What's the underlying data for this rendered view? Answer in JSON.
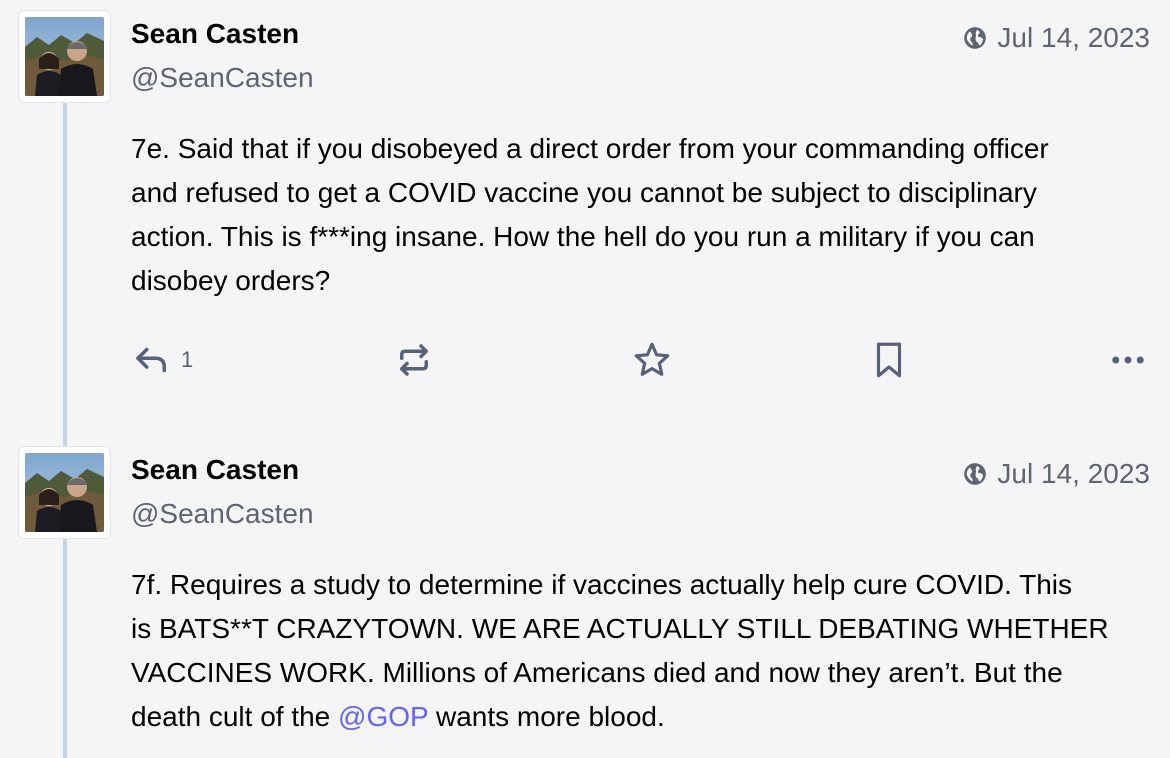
{
  "statuses": [
    {
      "display_name": "Sean Casten",
      "handle": "@SeanCasten",
      "date": "Jul 14, 2023",
      "visibility_icon": "globe-icon",
      "lines": [
        "7e. Said that if you disobeyed a direct order from your commanding officer",
        "and refused to get a COVID vaccine you cannot be subject to disciplinary",
        "action.  This is f***ing insane.  How the hell do you run a military if you can",
        "disobey orders?"
      ],
      "actions": {
        "reply_icon": "reply-icon",
        "reply_count": "1",
        "boost_icon": "boost-icon",
        "favourite_icon": "star-icon",
        "bookmark_icon": "bookmark-icon",
        "more_icon": "more-icon"
      }
    },
    {
      "display_name": "Sean Casten",
      "handle": "@SeanCasten",
      "date": "Jul 14, 2023",
      "visibility_icon": "globe-icon",
      "lines": [
        "7f. Requires a study to determine if vaccines actually help cure COVID.  This",
        "is BATS**T CRAZYTOWN.  WE ARE ACTUALLY STILL DEBATING WHETHER",
        "VACCINES WORK.  Millions of Americans died and now they aren’t.  But the"
      ],
      "last_line_prefix": "death cult of the ",
      "mention": "@GOP",
      "last_line_suffix": " wants more blood."
    }
  ],
  "colors": {
    "background": "#f5f5f8",
    "thread_line": "#c9d3e0",
    "secondary_text": "#5f6472",
    "action_icon": "#596179",
    "mention": "#6364ff"
  }
}
